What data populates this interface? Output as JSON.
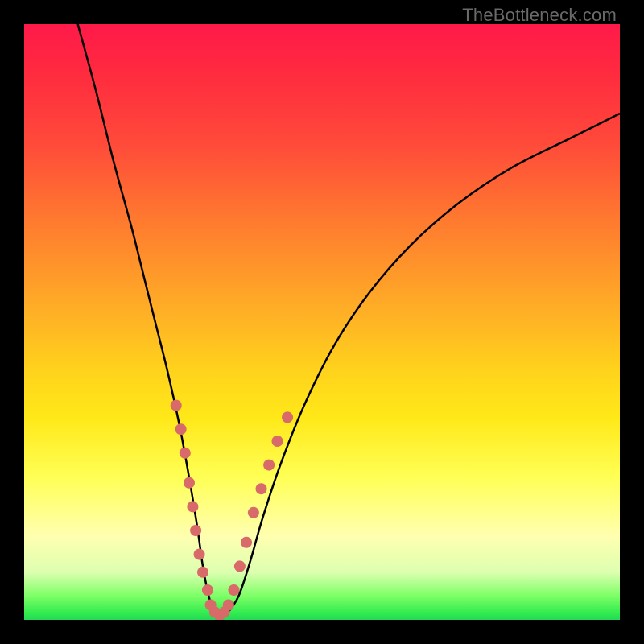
{
  "attribution": "TheBottleneck.com",
  "chart_data": {
    "type": "line",
    "title": "",
    "xlabel": "",
    "ylabel": "",
    "xlim": [
      0,
      100
    ],
    "ylim": [
      0,
      100
    ],
    "background_gradient": {
      "stops": [
        {
          "pos": 0.0,
          "color": "#ff1a4a"
        },
        {
          "pos": 0.08,
          "color": "#ff2a3f"
        },
        {
          "pos": 0.2,
          "color": "#ff4a3a"
        },
        {
          "pos": 0.33,
          "color": "#ff7a2f"
        },
        {
          "pos": 0.48,
          "color": "#ffae26"
        },
        {
          "pos": 0.58,
          "color": "#ffd21c"
        },
        {
          "pos": 0.66,
          "color": "#ffe818"
        },
        {
          "pos": 0.76,
          "color": "#ffff55"
        },
        {
          "pos": 0.86,
          "color": "#ffffb0"
        },
        {
          "pos": 0.92,
          "color": "#ddffb0"
        },
        {
          "pos": 0.96,
          "color": "#7dff66"
        },
        {
          "pos": 0.99,
          "color": "#2eea4f"
        },
        {
          "pos": 1.0,
          "color": "#26d856"
        }
      ]
    },
    "series": [
      {
        "name": "bottleneck-curve",
        "style": "solid-black",
        "x": [
          9,
          12,
          15,
          18,
          20,
          22,
          24,
          26,
          27.5,
          29,
          30,
          31,
          32,
          33,
          34,
          36,
          38,
          40,
          43,
          47,
          52,
          58,
          65,
          73,
          82,
          92,
          100
        ],
        "y": [
          100,
          89,
          77,
          66,
          58,
          50,
          42,
          33,
          25,
          16,
          9,
          4,
          1,
          0.5,
          1,
          4,
          10,
          17,
          26,
          36,
          46,
          55,
          63,
          70,
          76,
          81,
          85
        ]
      }
    ],
    "markers": {
      "name": "highlight-points",
      "color": "#d86a6a",
      "radius": 7,
      "points": [
        {
          "x": 25.5,
          "y": 36
        },
        {
          "x": 26.3,
          "y": 32
        },
        {
          "x": 27.0,
          "y": 28
        },
        {
          "x": 27.7,
          "y": 23
        },
        {
          "x": 28.3,
          "y": 19
        },
        {
          "x": 28.8,
          "y": 15
        },
        {
          "x": 29.4,
          "y": 11
        },
        {
          "x": 30.0,
          "y": 8
        },
        {
          "x": 30.8,
          "y": 5
        },
        {
          "x": 31.3,
          "y": 2.5
        },
        {
          "x": 32.0,
          "y": 1.3
        },
        {
          "x": 32.8,
          "y": 0.8
        },
        {
          "x": 33.6,
          "y": 1.3
        },
        {
          "x": 34.3,
          "y": 2.5
        },
        {
          "x": 35.2,
          "y": 5
        },
        {
          "x": 36.2,
          "y": 9
        },
        {
          "x": 37.3,
          "y": 13
        },
        {
          "x": 38.5,
          "y": 18
        },
        {
          "x": 39.8,
          "y": 22
        },
        {
          "x": 41.1,
          "y": 26
        },
        {
          "x": 42.5,
          "y": 30
        },
        {
          "x": 44.2,
          "y": 34
        }
      ]
    }
  }
}
